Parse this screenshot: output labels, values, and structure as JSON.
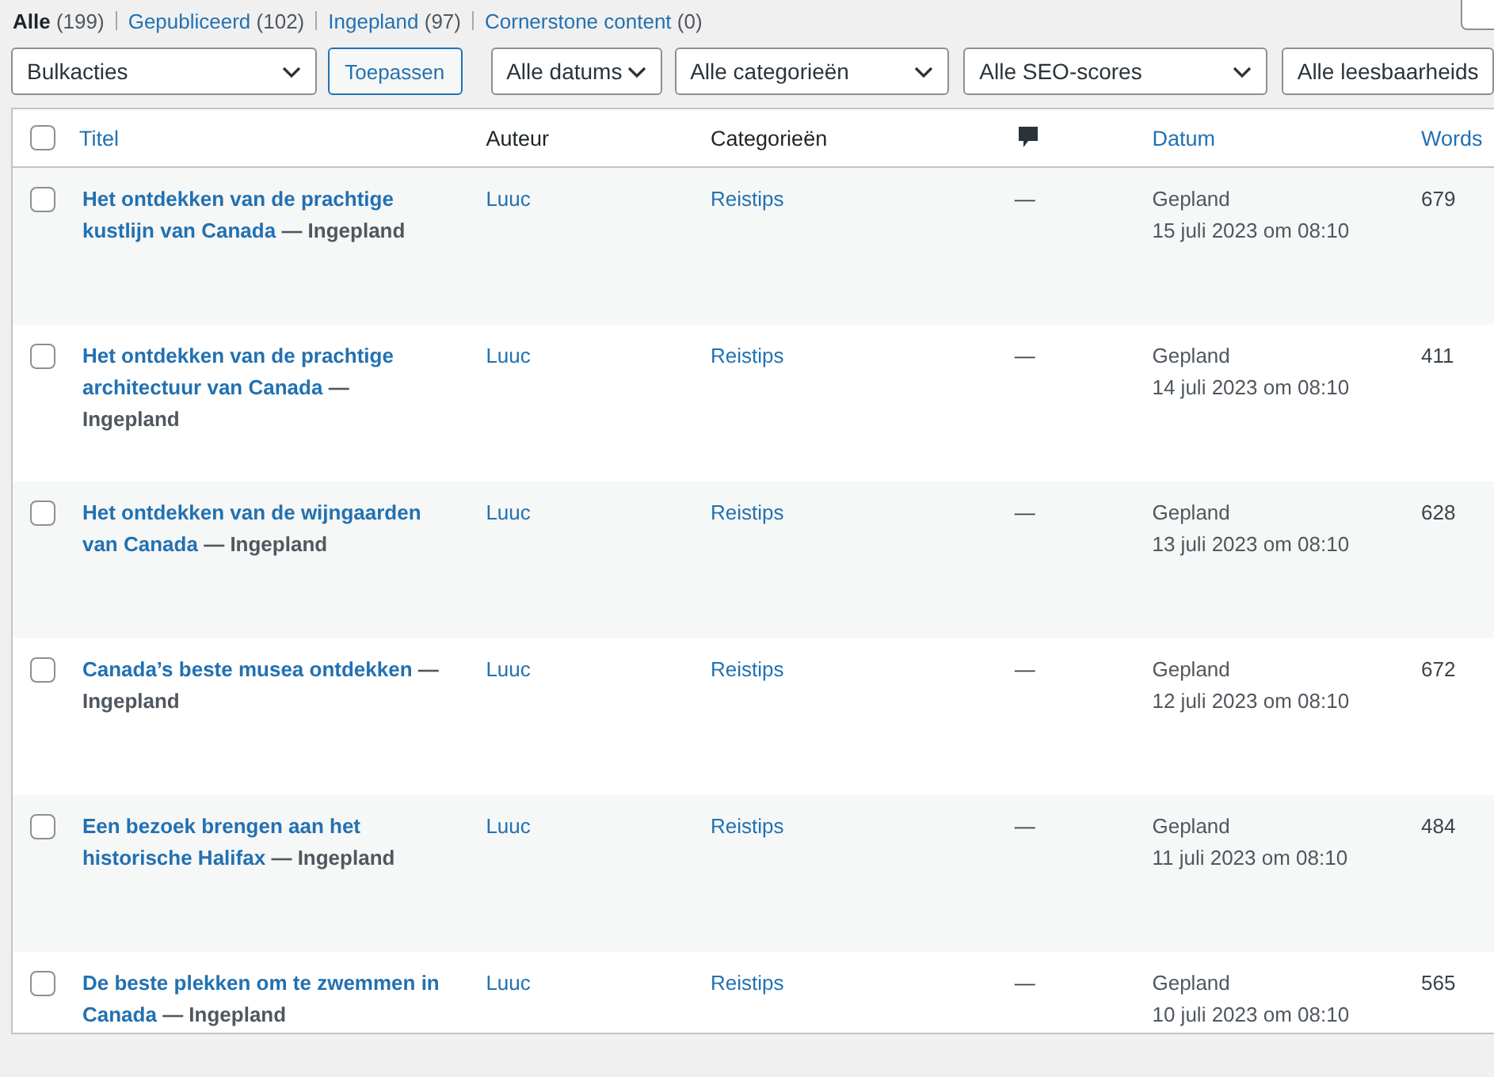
{
  "views": [
    {
      "label": "Alle",
      "count": "(199)",
      "selected": true
    },
    {
      "label": "Gepubliceerd",
      "count": "(102)",
      "selected": false
    },
    {
      "label": "Ingepland",
      "count": "(97)",
      "selected": false
    },
    {
      "label": "Cornerstone content",
      "count": "(0)",
      "selected": false
    }
  ],
  "bulk": {
    "select": "Bulkacties",
    "apply": "Toepassen"
  },
  "filters": [
    "Alle datums",
    "Alle categorieën",
    "Alle SEO-scores",
    "Alle leesbaarheids"
  ],
  "select_all": {
    "checked": false
  },
  "columns": [
    {
      "kind": "check"
    },
    {
      "kind": "link",
      "label": "Titel"
    },
    {
      "kind": "text",
      "label": "Auteur"
    },
    {
      "kind": "text",
      "label": "Categorieën"
    },
    {
      "kind": "comments"
    },
    {
      "kind": "link",
      "label": "Datum"
    },
    {
      "kind": "link",
      "label": "Words"
    }
  ],
  "rows": [
    {
      "title": "Het ontdekken van de prachtige kustlijn van Canada",
      "state": "— Ingepland",
      "author": "Luuc",
      "category": "Reistips",
      "comments": "—",
      "status": "Gepland",
      "date": "15 juli 2023 om 08:10",
      "words": "679",
      "checked": false
    },
    {
      "title": "Het ontdekken van de prachtige architectuur van Canada",
      "state": "— Ingepland",
      "author": "Luuc",
      "category": "Reistips",
      "comments": "—",
      "status": "Gepland",
      "date": "14 juli 2023 om 08:10",
      "words": "411",
      "checked": false
    },
    {
      "title": "Het ontdekken van de wijngaarden van Canada",
      "state": "— Ingepland",
      "author": "Luuc",
      "category": "Reistips",
      "comments": "—",
      "status": "Gepland",
      "date": "13 juli 2023 om 08:10",
      "words": "628",
      "checked": false
    },
    {
      "title": "Canada’s beste musea ontdekken",
      "state": "— Ingepland",
      "author": "Luuc",
      "category": "Reistips",
      "comments": "—",
      "status": "Gepland",
      "date": "12 juli 2023 om 08:10",
      "words": "672",
      "checked": false
    },
    {
      "title": "Een bezoek brengen aan het historische Halifax",
      "state": "— Ingepland",
      "author": "Luuc",
      "category": "Reistips",
      "comments": "—",
      "status": "Gepland",
      "date": "11 juli 2023 om 08:10",
      "words": "484",
      "checked": false
    },
    {
      "title": "De beste plekken om te zwemmen in Canada",
      "state": "— Ingepland",
      "author": "Luuc",
      "category": "Reistips",
      "comments": "—",
      "status": "Gepland",
      "date": "10 juli 2023 om 08:10",
      "words": "565",
      "checked": false
    }
  ]
}
